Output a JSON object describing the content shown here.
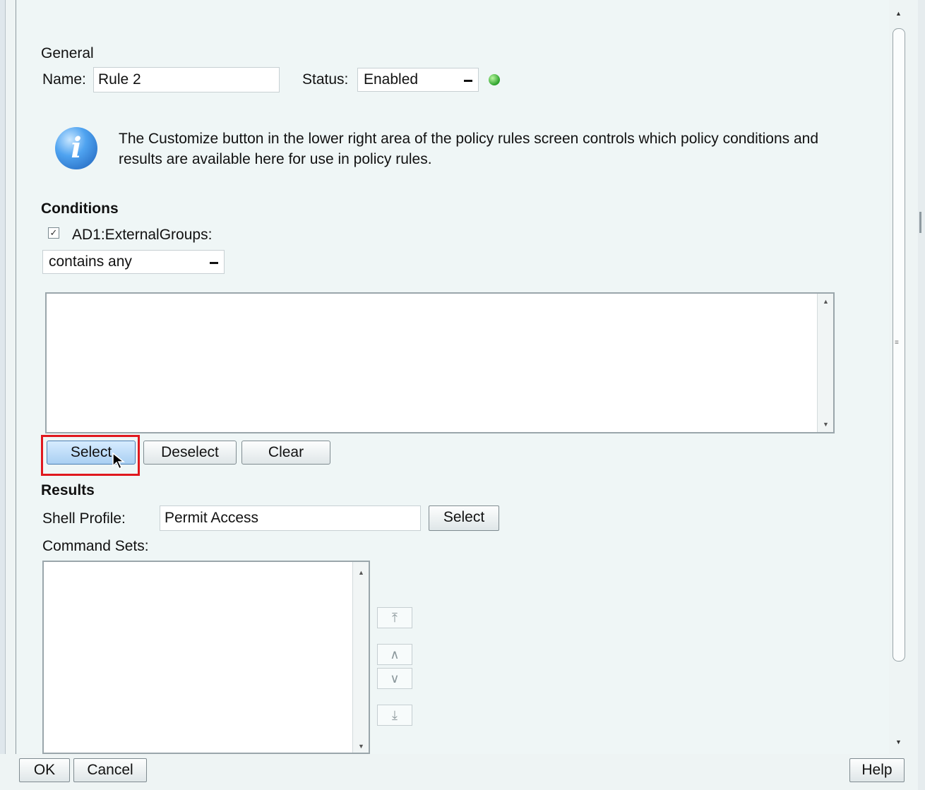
{
  "general": {
    "heading": "General",
    "name_label": "Name:",
    "name_value": "Rule 2",
    "status_label": "Status:",
    "status_value": "Enabled"
  },
  "info": {
    "text": "The Customize button in the lower right area of the policy rules screen controls which policy conditions and results are available here for use in policy rules."
  },
  "conditions": {
    "heading": "Conditions",
    "checkbox_label": "AD1:ExternalGroups:",
    "checkbox_checked": true,
    "operator_value": "contains any",
    "buttons": {
      "select": "Select",
      "deselect": "Deselect",
      "clear": "Clear"
    }
  },
  "results": {
    "heading": "Results",
    "shell_profile_label": "Shell Profile:",
    "shell_profile_value": "Permit Access",
    "shell_profile_select": "Select",
    "command_sets_label": "Command Sets:"
  },
  "footer": {
    "ok": "OK",
    "cancel": "Cancel",
    "help": "Help"
  },
  "colors": {
    "highlight": "#e0181e",
    "status_dot": "#2aa12a",
    "info_icon": "#1c5fb8"
  }
}
